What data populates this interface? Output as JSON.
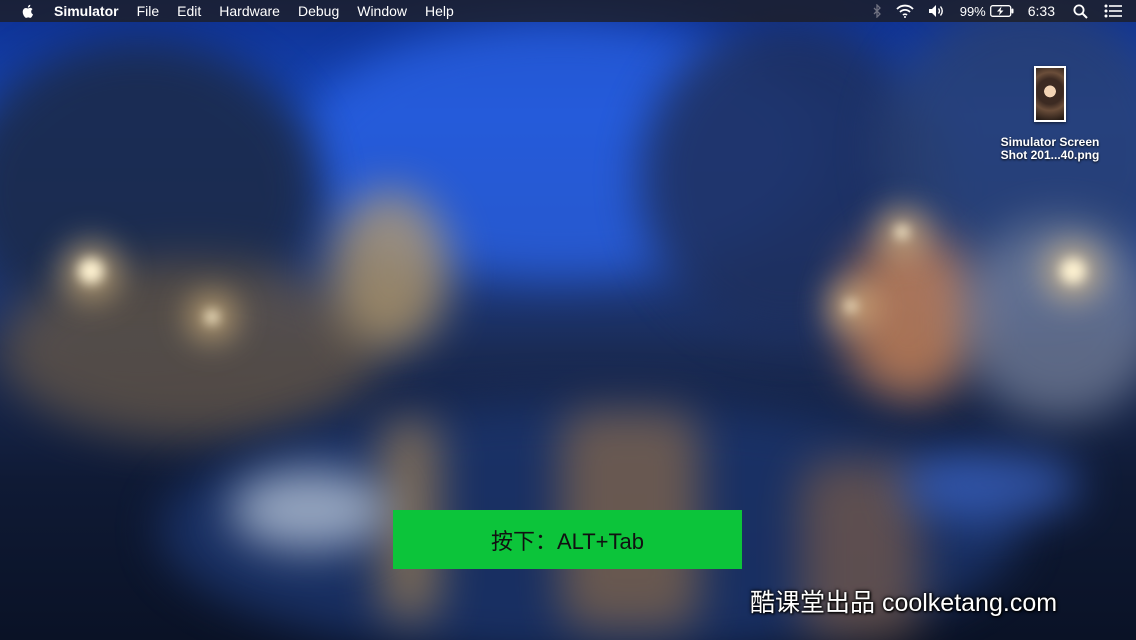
{
  "menubar": {
    "app_name": "Simulator",
    "items": [
      "File",
      "Edit",
      "Hardware",
      "Debug",
      "Window",
      "Help"
    ],
    "status": {
      "icons": [
        "bluetooth-icon",
        "wifi-icon",
        "volume-icon",
        "battery-charging-icon",
        "spotlight-search-icon",
        "notification-center-icon"
      ],
      "battery_percent": "99%",
      "clock": "6:33"
    }
  },
  "desktop": {
    "file": {
      "name_line1": "Simulator Screen",
      "name_line2": "Shot 201...40.png"
    }
  },
  "overlay": {
    "instruction": "按下：ALT+Tab",
    "instruction_color": "#0cc43a",
    "watermark": "酷课堂出品 coolketang.com"
  }
}
